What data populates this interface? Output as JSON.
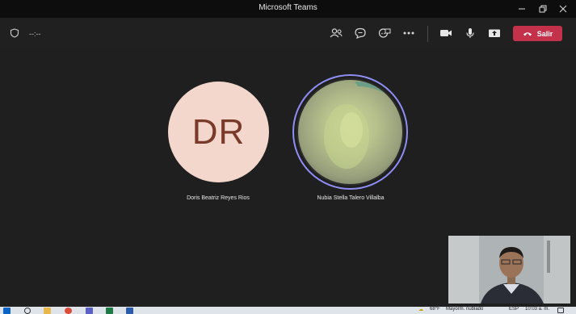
{
  "window": {
    "title": "Microsoft Teams"
  },
  "toolbar": {
    "timer": "--:--",
    "leave_label": "Salir",
    "icons": [
      "shield-icon",
      "people-icon",
      "chat-icon",
      "reactions-icon",
      "more-icon",
      "camera-icon",
      "mic-icon",
      "share-icon"
    ]
  },
  "participants": [
    {
      "initials": "DR",
      "name": "Doris Beatriz Reyes Rios",
      "avatar_color": "#f3d6cc"
    },
    {
      "initials": "",
      "name": "Nubia Stella Talero Villalba",
      "ring_color": "#8f8ef5"
    }
  ],
  "taskbar": {
    "time": "10:03 a. m.",
    "weather": "68°F",
    "weather_desc": "Mayorm. nublado",
    "language": "ESP"
  },
  "colors": {
    "leave": "#c4314b",
    "background": "#1f1f1f",
    "titlebar": "#0d0d0d"
  }
}
